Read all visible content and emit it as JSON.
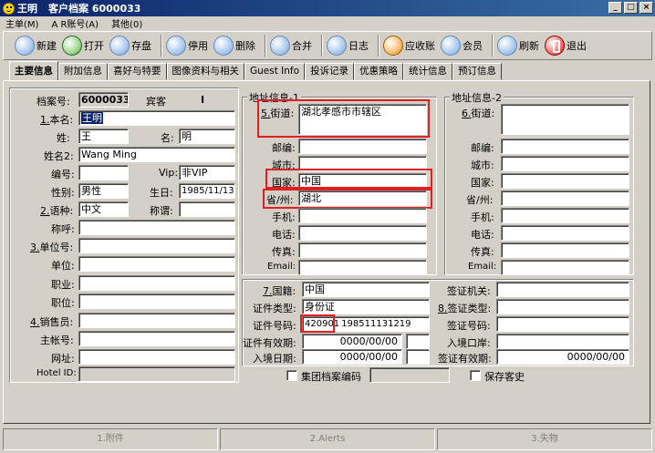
{
  "window": {
    "name": "王明",
    "title": "客户档案 6000033",
    "min": "_",
    "max": "□",
    "close": "×"
  },
  "menu": [
    "主单(M)",
    "A R账号(A)",
    "其他(0)"
  ],
  "toolbar": [
    "新建",
    "打开",
    "存盘",
    "停用",
    "删除",
    "合并",
    "日志",
    "应收账",
    "会员",
    "刷新",
    "退出"
  ],
  "tabs": [
    "主要信息",
    "附加信息",
    "喜好与特要",
    "图像资料与相关",
    "Guest Info",
    "投诉记录",
    "优惠策略",
    "统计信息",
    "预订信息"
  ],
  "profile": {
    "dang_an_hao_label": "档案号:",
    "dang_an_hao": "6000033",
    "guest_type": "宾客",
    "i_label": "I",
    "ben_ming_num": "1.",
    "ben_ming_label": "本名:",
    "ben_ming": "王明",
    "xing_label": "姓:",
    "xing": "王",
    "ming_label": "名:",
    "ming": "明",
    "xingming2_label": "姓名2:",
    "xingming2": "Wang Ming",
    "bianhao_label": "编号:",
    "bianhao": "",
    "vip_label": "Vip:",
    "vip": "非VIP",
    "xingbie_label": "性别:",
    "xingbie": "男性",
    "shengri_label": "生日:",
    "shengri": "1985/11/13",
    "yuzhong_num": "2.",
    "yuzhong_label": "语种:",
    "yuzhong": "中文",
    "chengwei_label": "称谓:",
    "chengwei": "",
    "chenghu_label": "称呼:",
    "chenghu": "",
    "danweihao_num": "3.",
    "danweihao_label": "单位号:",
    "danweihao": "",
    "danwei_label": "单位:",
    "danwei": "",
    "zhiye_label": "职业:",
    "zhiye": "",
    "zhiwei_label": "职位:",
    "zhiwei": "",
    "xiaoshouyuan_num": "4.",
    "xiaoshouyuan_label": "销售员:",
    "xiaoshouyuan": "",
    "zhuzhanghao_label": "主帐号:",
    "zhuzhanghao": "",
    "wangzhi_label": "网址:",
    "wangzhi": "",
    "hotel_id_label": "Hotel ID:",
    "hotel_id": ""
  },
  "address1": {
    "title": "地址信息-1",
    "street_num": "5.",
    "street_label": "街道:",
    "street": "湖北孝感市市辖区",
    "postcode_label": "邮编:",
    "postcode": "",
    "city_label": "城市:",
    "city": "",
    "country_label": "国家:",
    "country": "中国",
    "province_label": "省/州:",
    "province": "湖北",
    "mobile_label": "手机:",
    "mobile": "",
    "phone_label": "电话:",
    "phone": "",
    "fax_label": "传真:",
    "fax": "",
    "email_label": "Email:",
    "email": ""
  },
  "address2": {
    "title": "地址信息-2",
    "street_num": "6.",
    "street_label": "街道:",
    "street": "",
    "postcode_label": "邮编:",
    "city_label": "城市:",
    "country_label": "国家:",
    "province_label": "省/州:",
    "mobile_label": "手机:",
    "phone_label": "电话:",
    "fax_label": "传真:",
    "email_label": "Email:"
  },
  "identity": {
    "nationality_num": "7.",
    "nationality_label": "国籍:",
    "nationality": "中国",
    "id_type_label": "证件类型:",
    "id_type": "身份证",
    "id_no_label": "证件号码:",
    "id_no_a": "420901",
    "id_no_b": "198511131219",
    "id_valid_label": "证件有效期:",
    "id_valid": "0000/00/00",
    "entry_date_label": "入境日期:",
    "entry_date": "0000/00/00"
  },
  "visa": {
    "authority_label": "签证机关:",
    "type_num": "8.",
    "type_label": "签证类型:",
    "no_label": "签证号码:",
    "port_label": "入境口岸:",
    "valid_label": "签证有效期:",
    "valid": "0000/00/00"
  },
  "group_code_label": "集团档案编码",
  "keep_guest_label": "保存客史",
  "status": [
    "1.附件",
    "2.Alerts",
    "3.失物"
  ]
}
